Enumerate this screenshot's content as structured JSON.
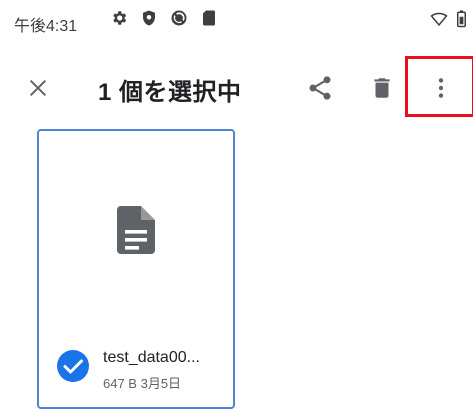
{
  "status": {
    "time": "午後4:31",
    "icons": [
      "gear-icon",
      "shield-icon",
      "sync-icon",
      "sd-card-icon"
    ],
    "right_icons": [
      "wifi-icon",
      "battery-icon"
    ]
  },
  "toolbar": {
    "title": "1 個を選択中",
    "actions": [
      "close-icon",
      "share-icon",
      "delete-icon",
      "more-vert-icon"
    ],
    "highlight_color": "#e8101a"
  },
  "file": {
    "name": "test_data00...",
    "meta": "647 B 3月5日",
    "selected": true,
    "icon": "document-icon",
    "border_color": "#4e86d6",
    "check_color": "#1a73e8"
  }
}
